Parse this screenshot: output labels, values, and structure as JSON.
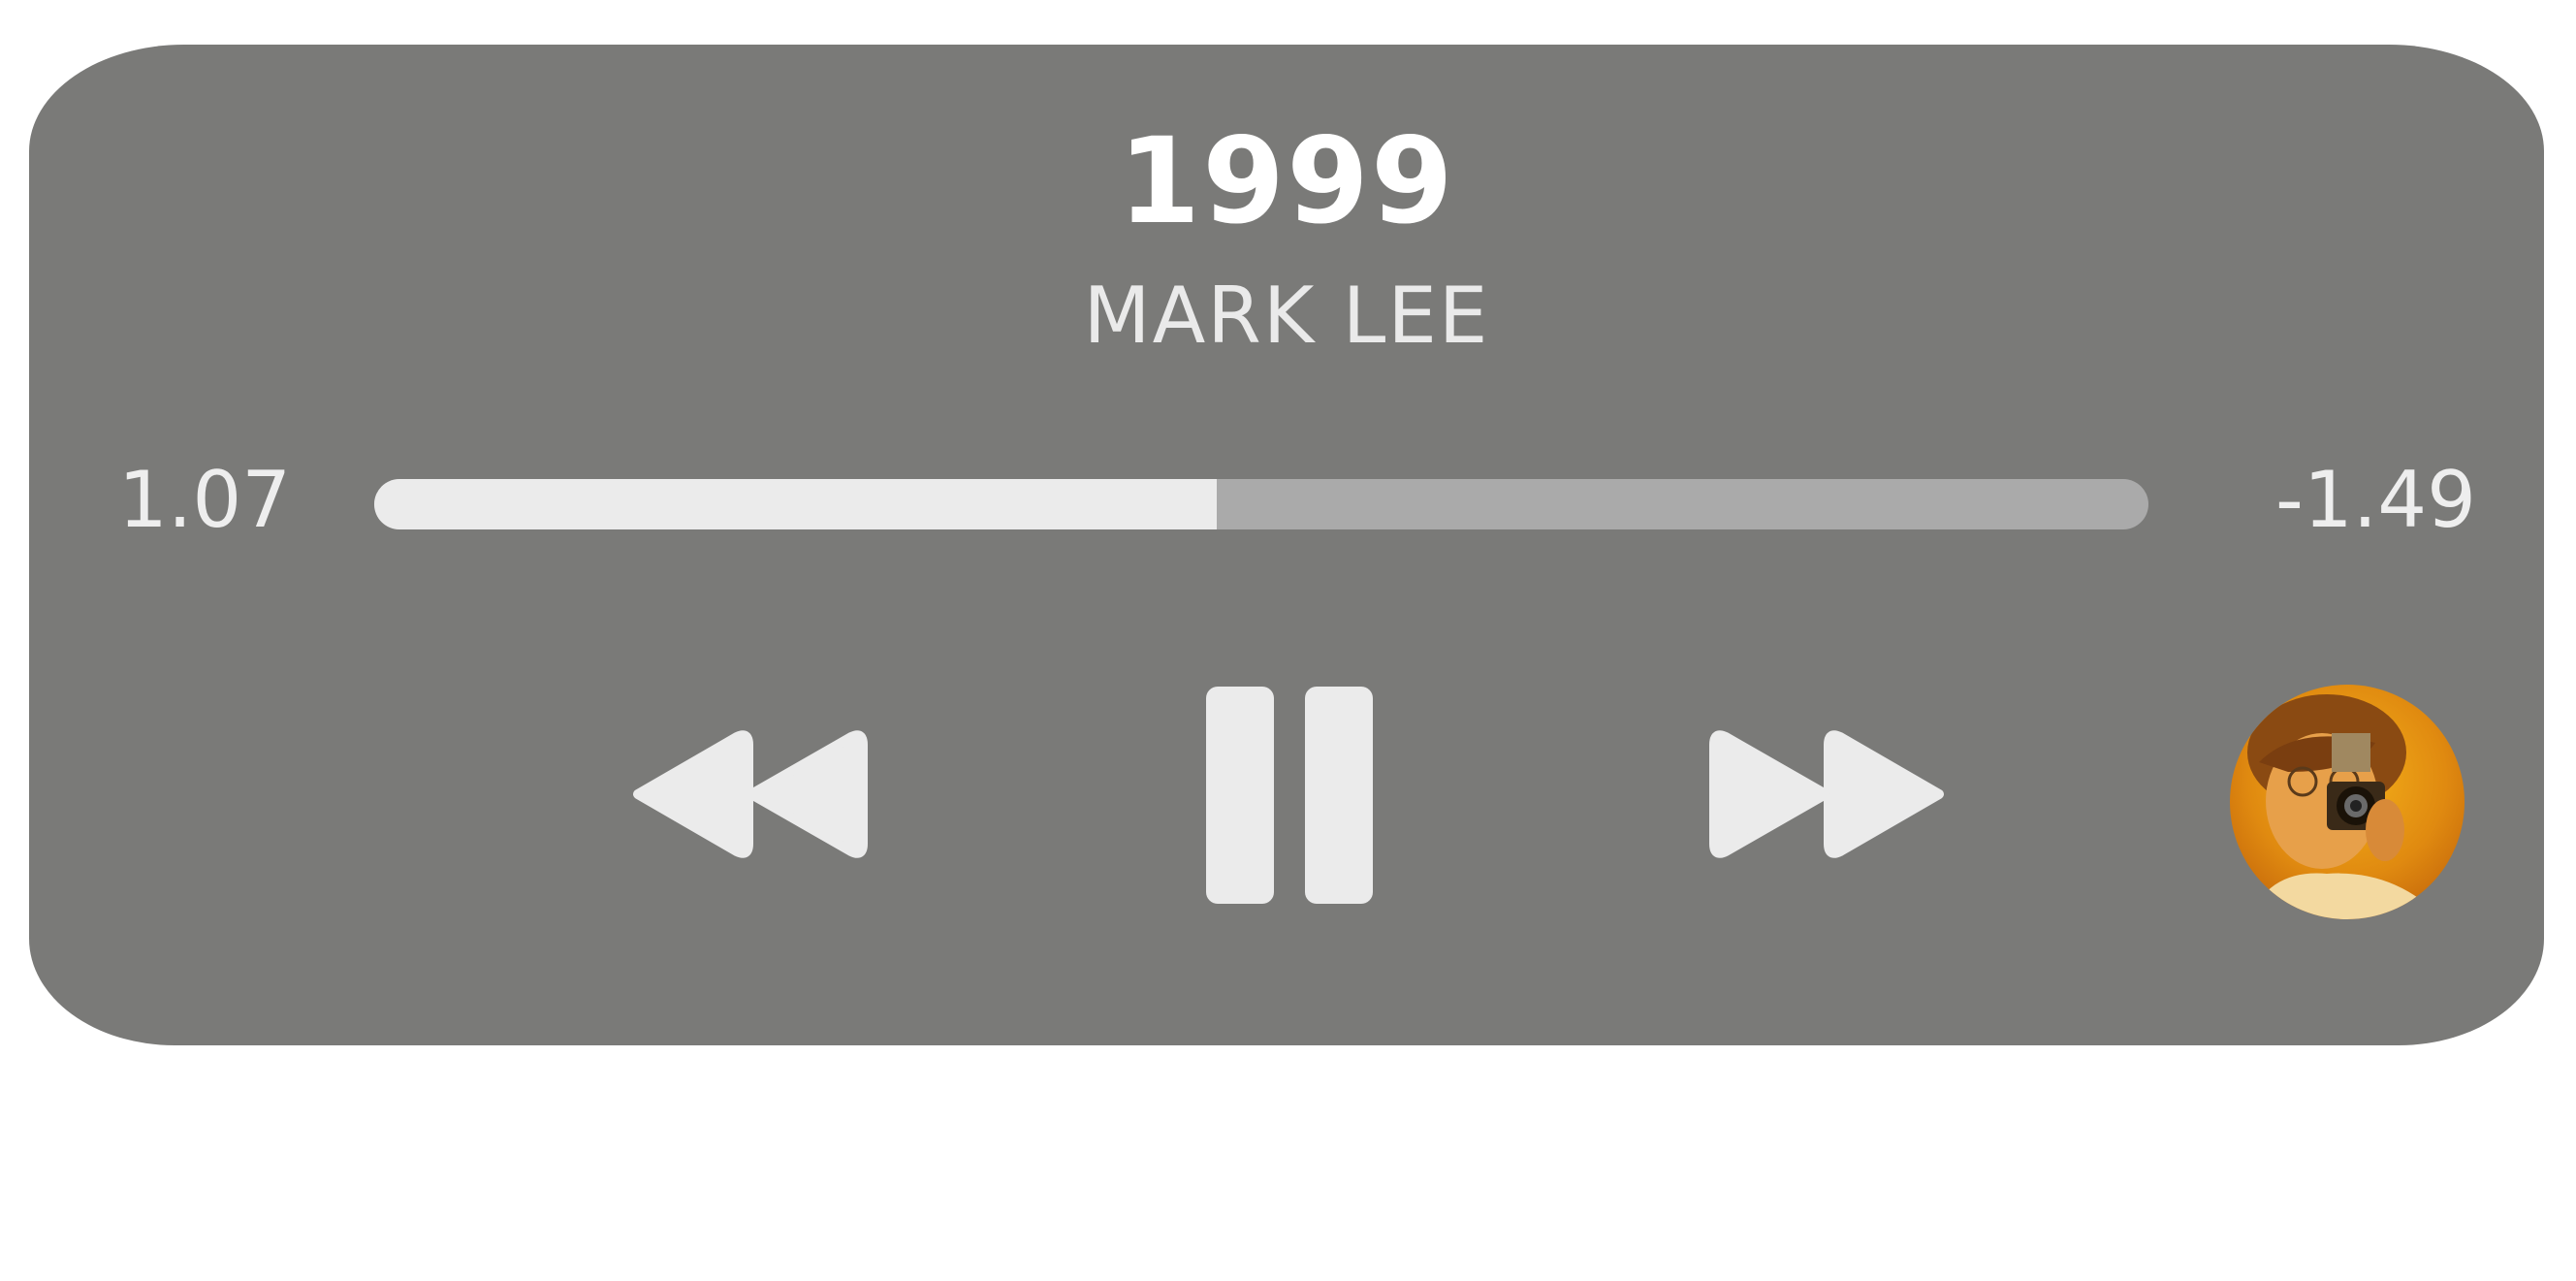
{
  "track": {
    "title": "1999",
    "artist": "MARK LEE"
  },
  "progress": {
    "elapsed": "1.07",
    "remaining": "-1.49",
    "fraction": 0.475
  },
  "controls": {
    "rewind_icon": "rewind-icon",
    "pause_icon": "pause-icon",
    "forward_icon": "fast-forward-icon"
  },
  "colors": {
    "player_bg": "#7a7a78",
    "track_empty": "#aaaaaa",
    "track_filled": "#ebebeb",
    "icon": "#ebebeb"
  }
}
